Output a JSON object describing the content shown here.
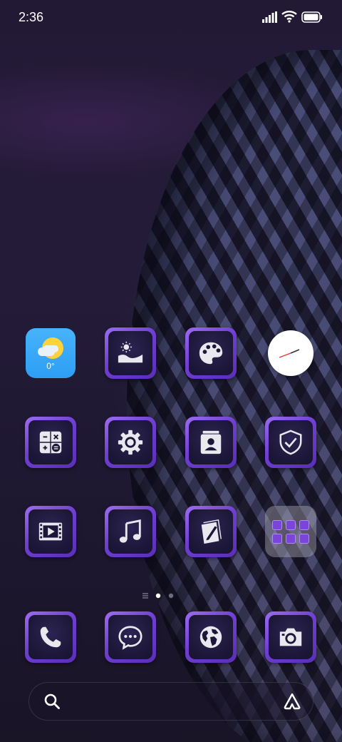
{
  "status_bar": {
    "time": "2:36"
  },
  "home": {
    "weather": {
      "temperature": "0°"
    },
    "pager": {
      "pages": 2,
      "current": 1
    }
  },
  "apps": [
    {
      "name": "weather-app",
      "icon": "weather-icon"
    },
    {
      "name": "gallery-app",
      "icon": "mountain-sun-icon"
    },
    {
      "name": "themes-app",
      "icon": "palette-icon"
    },
    {
      "name": "clock-app",
      "icon": "clock-icon"
    },
    {
      "name": "calculator-app",
      "icon": "calculator-icon"
    },
    {
      "name": "settings-app",
      "icon": "gear-icon"
    },
    {
      "name": "contacts-app",
      "icon": "contact-card-icon"
    },
    {
      "name": "security-app",
      "icon": "shield-check-icon"
    },
    {
      "name": "video-app",
      "icon": "film-play-icon"
    },
    {
      "name": "music-app",
      "icon": "music-note-icon"
    },
    {
      "name": "notes-app",
      "icon": "note-pencil-icon"
    },
    {
      "name": "app-folder",
      "icon": "folder-icon"
    },
    {
      "name": "phone-app",
      "icon": "phone-icon"
    },
    {
      "name": "messages-app",
      "icon": "chat-bubble-icon"
    },
    {
      "name": "browser-app",
      "icon": "globe-icon"
    },
    {
      "name": "camera-app",
      "icon": "camera-icon"
    }
  ],
  "colors": {
    "tile_border": "#7a45d8",
    "tile_inner": "#1c1738",
    "weather_bg": "#2d9ef5",
    "sun": "#ffd23a"
  }
}
